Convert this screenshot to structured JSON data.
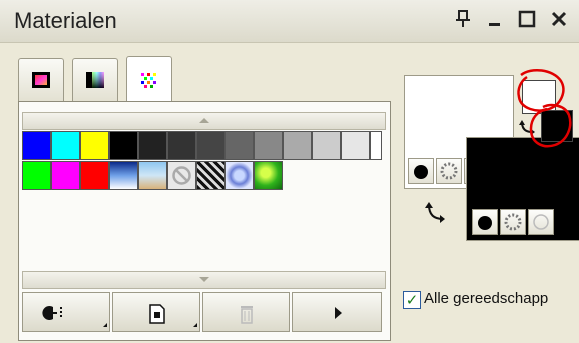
{
  "window": {
    "title": "Materialen",
    "buttons": {
      "pin": "ᴪ",
      "minimize": "_",
      "maximize": "□",
      "close": "×"
    }
  },
  "tabs": [
    {
      "name": "Frame",
      "icon": "frame-icon"
    },
    {
      "name": "Spectrum",
      "icon": "spectrum-icon"
    },
    {
      "name": "Swatches",
      "icon": "swatches-icon"
    }
  ],
  "swatch_rows": [
    [
      "#0000ff",
      "#00ffff",
      "#ffff00",
      "#000000",
      "#222222",
      "#333333",
      "#444444",
      "#666666",
      "#888888",
      "#aaaaaa",
      "#cccccc",
      "#e6e6e6",
      "#ffffff"
    ],
    [
      "#00ff00",
      "#ff00ff",
      "#ff0000",
      "gradient-blue",
      "gradient-sky",
      "null-swatch",
      "pattern-zebra",
      "pattern-blue",
      "texture-green"
    ]
  ],
  "bottom_toolbar": [
    "palette-menu-icon",
    "new-swatch-icon",
    "delete-swatch-icon",
    "play-arrow-icon"
  ],
  "materials": {
    "foreground": "#ffffff",
    "background": "#000000",
    "small_foreground": "#ffffff",
    "small_background": "#000000"
  },
  "checkbox": {
    "label": "Alle gereedschapp",
    "checked": true
  },
  "annotation_color": "#e00000"
}
